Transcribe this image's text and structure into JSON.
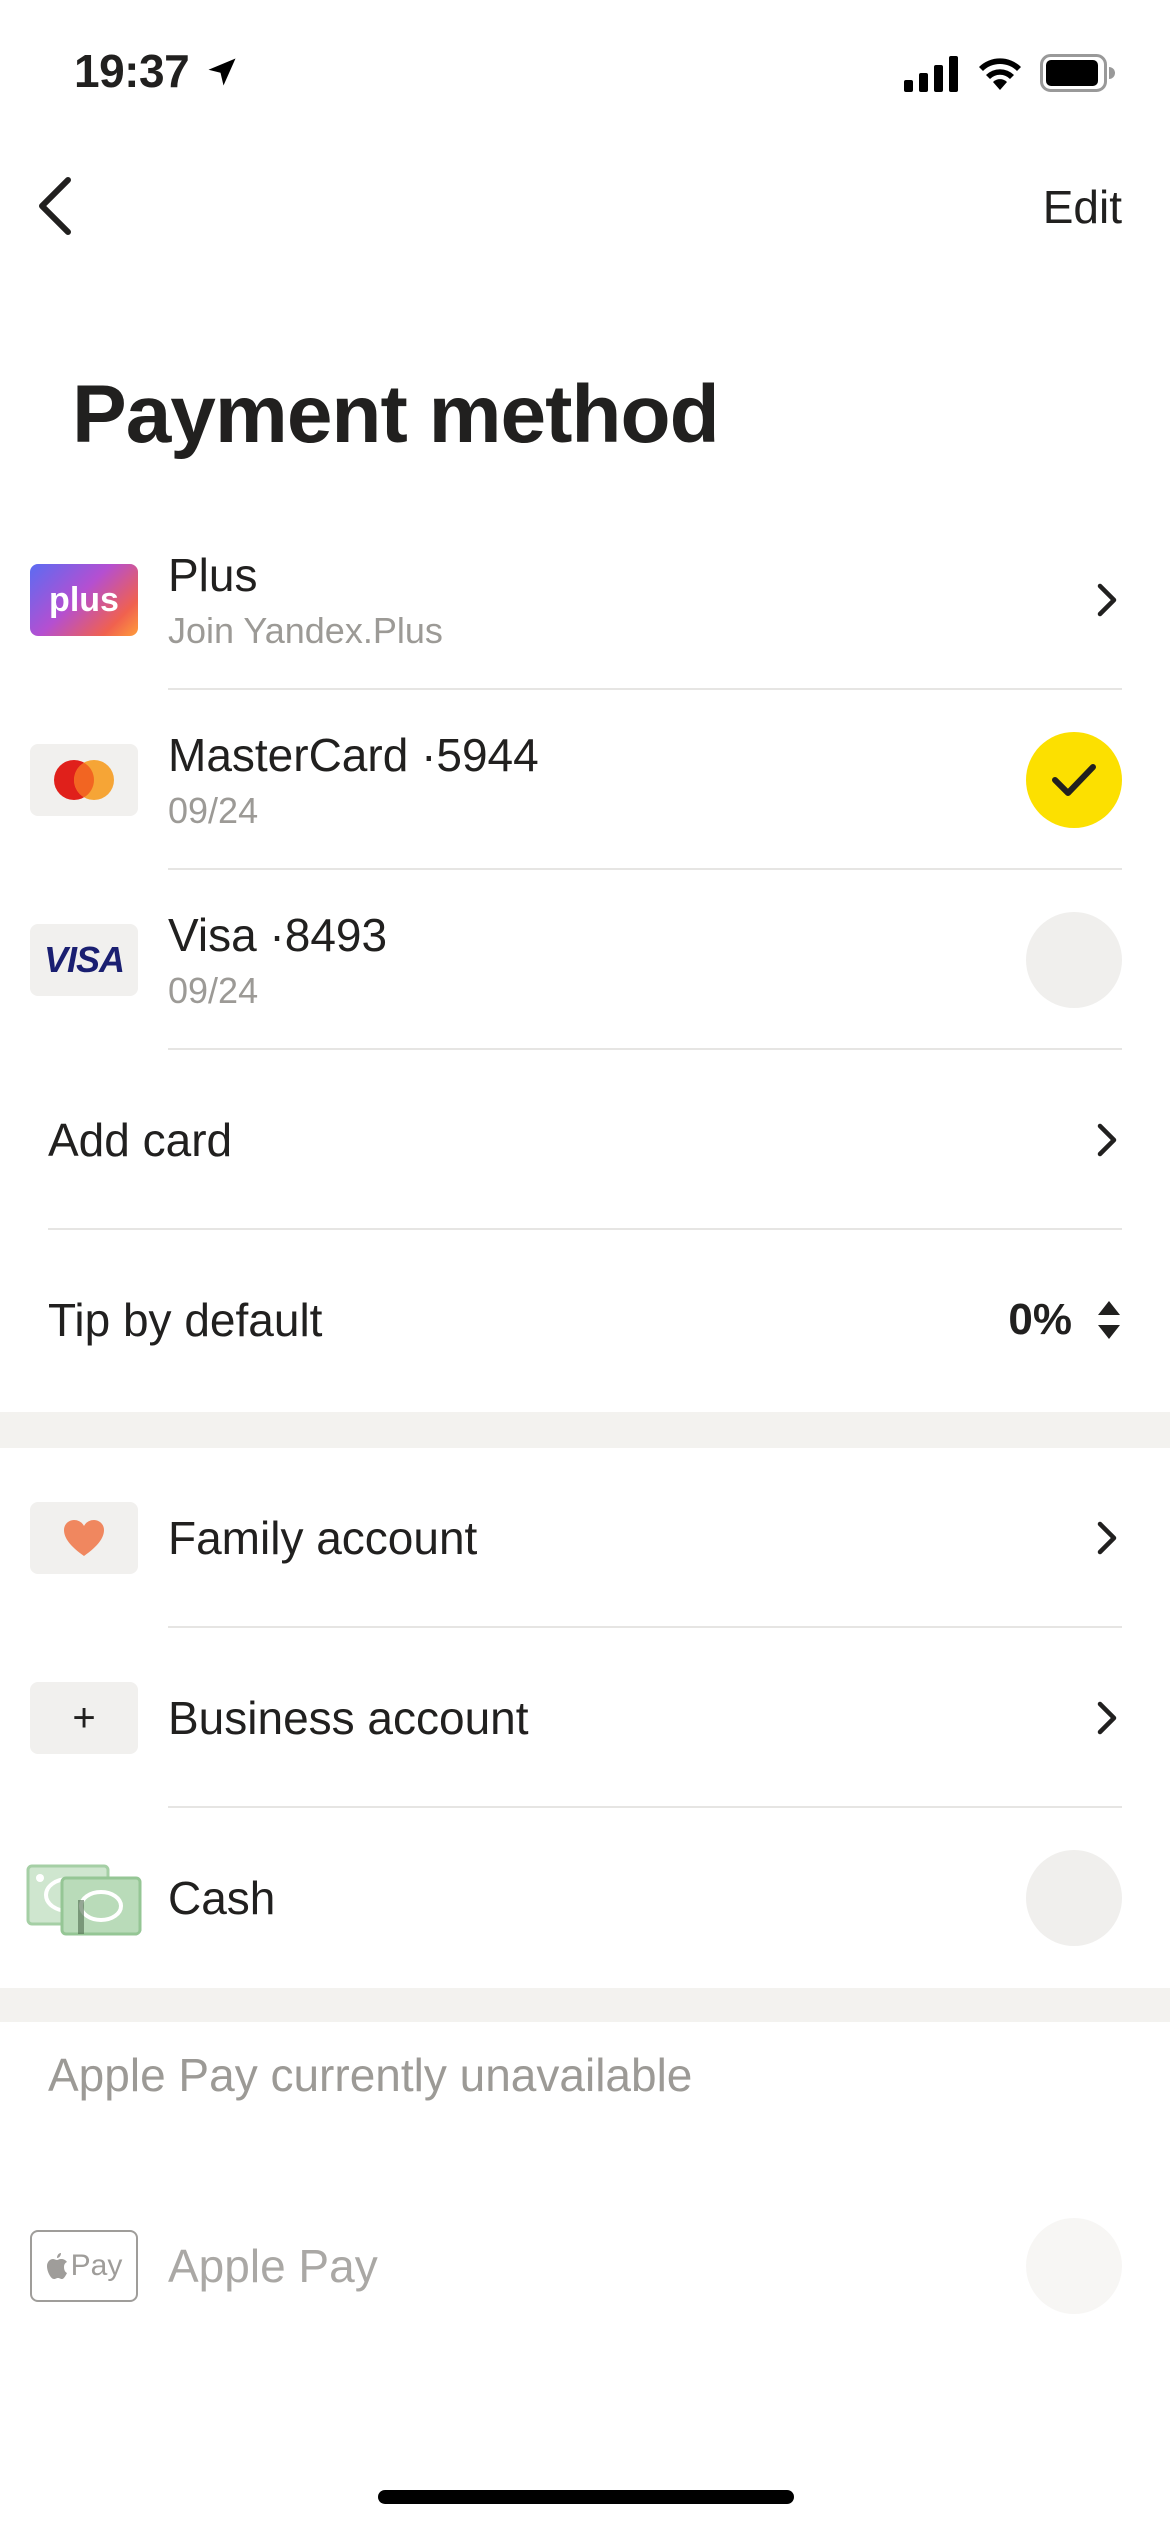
{
  "status_bar": {
    "time": "19:37"
  },
  "nav": {
    "edit_label": "Edit"
  },
  "title": "Payment method",
  "cards": [
    {
      "logo": "plus",
      "title": "Plus",
      "subtitle": "Join Yandex.Plus"
    },
    {
      "title": "MasterCard ·5944",
      "subtitle": "09/24",
      "selected": true
    },
    {
      "logo": "VISA",
      "title": "Visa ·8493",
      "subtitle": "09/24",
      "selected": false
    }
  ],
  "add_card_label": "Add card",
  "tip": {
    "label": "Tip by default",
    "value": "0%"
  },
  "accounts": [
    {
      "title": "Family account"
    },
    {
      "title": "Business account",
      "icon_glyph": "+"
    },
    {
      "title": "Cash",
      "selected": false
    }
  ],
  "apple_pay": {
    "notice": "Apple Pay currently unavailable",
    "logo_text": "Pay",
    "title": "Apple Pay"
  },
  "colors": {
    "accent_yellow": "#fce000",
    "divider": "#e6e5e3",
    "secondary_text": "#9c9a96",
    "section_gap": "#f3f2ef"
  }
}
